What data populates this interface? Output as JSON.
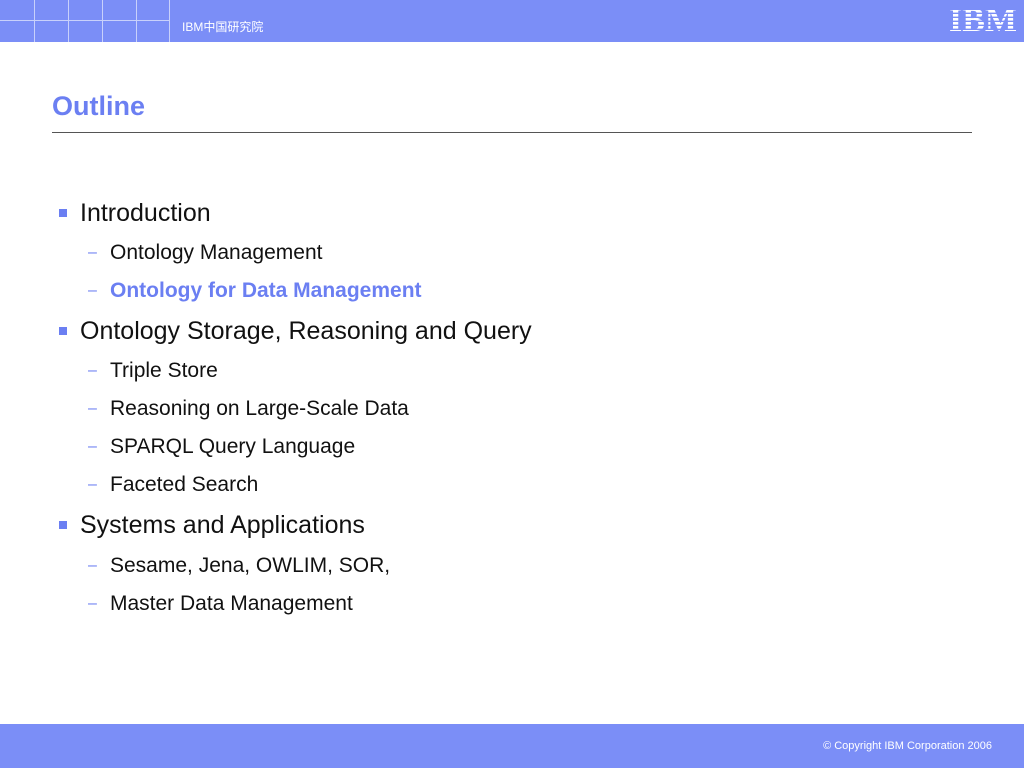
{
  "header": {
    "label": "IBM中国研究院",
    "logo_text": "IBM",
    "colors": {
      "bar": "#7b8ef7",
      "accent": "#6b7ff2"
    }
  },
  "slide": {
    "title": "Outline",
    "items": [
      {
        "level": 1,
        "text": "Introduction",
        "highlight": false
      },
      {
        "level": 2,
        "text": "Ontology Management",
        "highlight": false
      },
      {
        "level": 2,
        "text": "Ontology for Data Management",
        "highlight": true
      },
      {
        "level": 1,
        "text": "Ontology Storage, Reasoning and Query",
        "highlight": false
      },
      {
        "level": 2,
        "text": "Triple Store",
        "highlight": false
      },
      {
        "level": 2,
        "text": "Reasoning on Large-Scale Data",
        "highlight": false
      },
      {
        "level": 2,
        "text": "SPARQL Query Language",
        "highlight": false
      },
      {
        "level": 2,
        "text": "Faceted Search",
        "highlight": false
      },
      {
        "level": 1,
        "text": "Systems and Applications",
        "highlight": false
      },
      {
        "level": 2,
        "text": "Sesame, Jena, OWLIM, SOR,",
        "highlight": false
      },
      {
        "level": 2,
        "text": "Master Data Management",
        "highlight": false
      }
    ]
  },
  "footer": {
    "copyright": "© Copyright IBM Corporation 2006"
  }
}
